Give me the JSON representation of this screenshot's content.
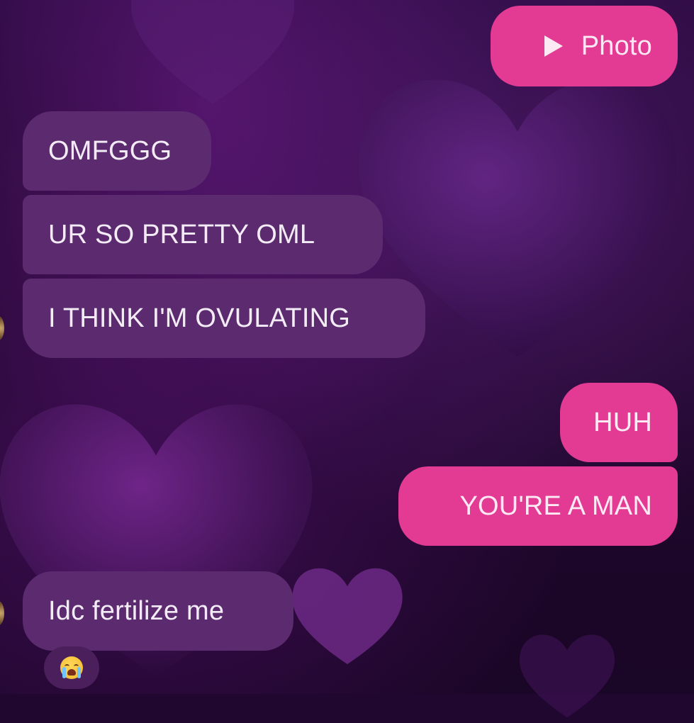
{
  "colors": {
    "incoming_bubble": "#5c2a6e",
    "outgoing_bubble": "#e33a93",
    "background": "#1f0730",
    "text_light": "#f3ecf6"
  },
  "messages": [
    {
      "direction": "outgoing",
      "type": "photo",
      "icon": "play-icon",
      "text": "Photo"
    },
    {
      "direction": "incoming",
      "text": "OMFGGG"
    },
    {
      "direction": "incoming",
      "text": "UR SO PRETTY OML"
    },
    {
      "direction": "incoming",
      "text": "I THINK I'M OVULATING"
    },
    {
      "direction": "outgoing",
      "text": "HUH"
    },
    {
      "direction": "outgoing",
      "text": "YOU'RE A MAN"
    },
    {
      "direction": "incoming",
      "text": "Idc fertilize me",
      "reaction_icon": "crying-face-icon"
    }
  ]
}
